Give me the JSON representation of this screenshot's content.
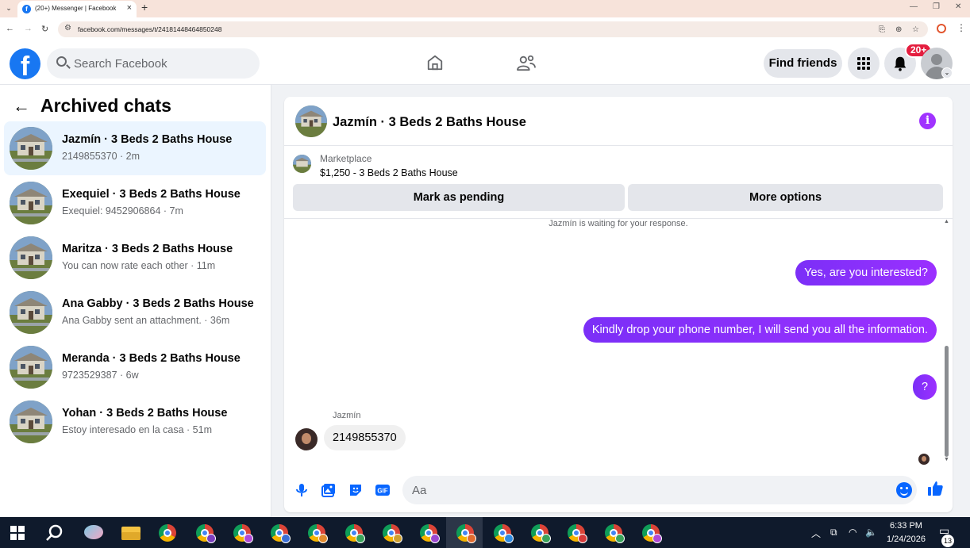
{
  "browser": {
    "tab_title": "(20+) Messenger | Facebook",
    "url": "facebook.com/messages/t/24181448464850248"
  },
  "header": {
    "logo": "f",
    "search_placeholder": "Search Facebook",
    "find_friends_label": "Find friends",
    "notification_badge": "20+"
  },
  "sidebar": {
    "title": "Archived chats",
    "chats": [
      {
        "name": "Jazmín · 3 Beds 2 Baths House",
        "subtitle": "2149855370 · 2m"
      },
      {
        "name": "Exequiel · 3 Beds 2 Baths House",
        "subtitle": "Exequiel: 9452906864 · 7m"
      },
      {
        "name": "Maritza · 3 Beds 2 Baths House",
        "subtitle": "You can now rate each other · 11m"
      },
      {
        "name": "Ana Gabby · 3 Beds 2 Baths House",
        "subtitle": "Ana Gabby sent an attachment. · 36m"
      },
      {
        "name": "Meranda · 3 Beds 2 Baths House",
        "subtitle": "9723529387 · 6w"
      },
      {
        "name": "Yohan · 3 Beds 2 Baths House",
        "subtitle": "Estoy interesado en la casa · 51m"
      }
    ]
  },
  "conversation": {
    "title": "Jazmín · 3 Beds 2 Baths House",
    "marketplace_label": "Marketplace",
    "listing": "$1,250 - 3 Beds 2 Baths House",
    "mark_pending_label": "Mark as pending",
    "more_options_label": "More options",
    "waiting_notice": "Jazmín is waiting for your response.",
    "outgoing": [
      "Yes, are you interested?",
      "Kindly drop your phone number, I will send you all the information.",
      "?"
    ],
    "incoming_sender": "Jazmín",
    "incoming": "2149855370",
    "composer_placeholder": "Aa"
  },
  "taskbar": {
    "time": "6:33 PM",
    "date": "1/24/2026",
    "notification_count": "13"
  },
  "colors": {
    "brand": "#1877f2",
    "accent_purple": "#8a2be2",
    "messenger_blue": "#0866ff",
    "badge_red": "#e41e3f"
  }
}
